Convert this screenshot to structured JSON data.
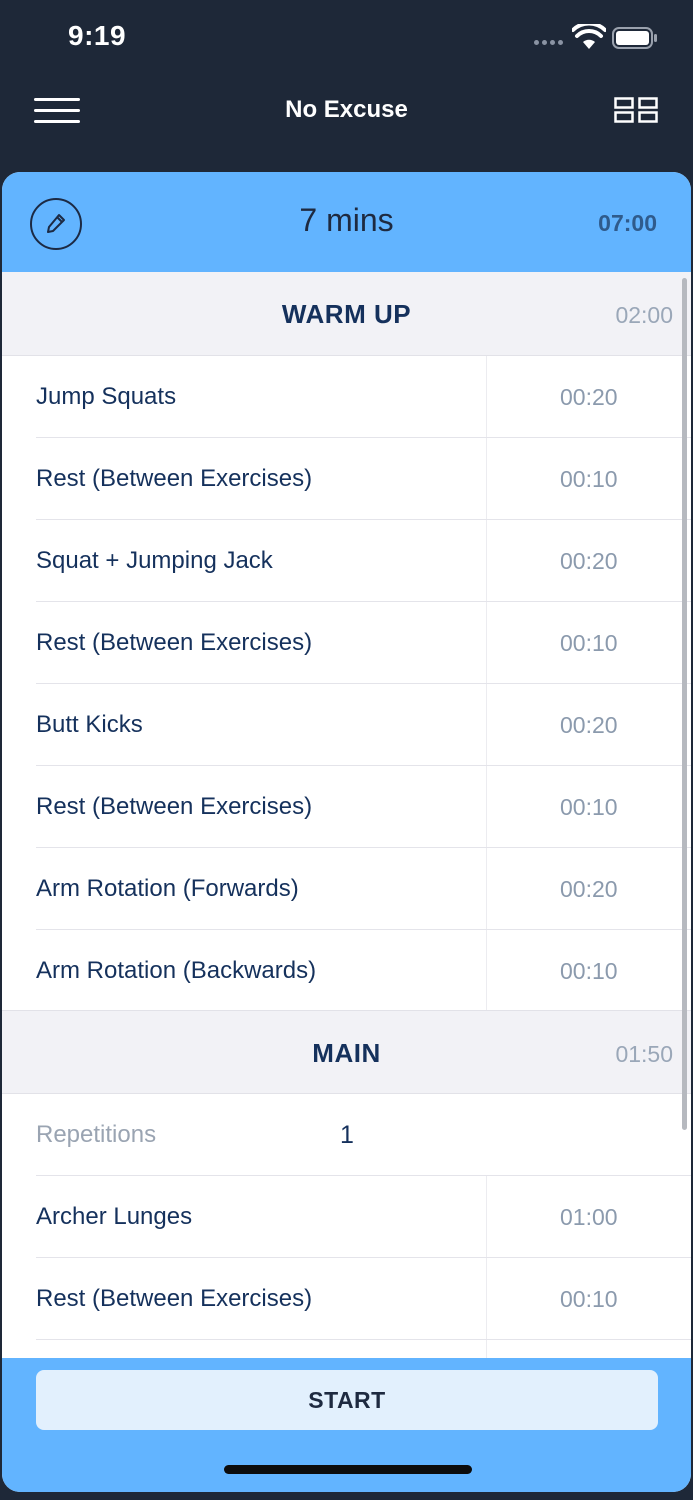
{
  "status": {
    "time": "9:19"
  },
  "nav": {
    "title": "No Excuse"
  },
  "header": {
    "title": "7 mins",
    "total": "07:00"
  },
  "sections": [
    {
      "title": "WARM UP",
      "time": "02:00",
      "items": [
        {
          "name": "Jump Squats",
          "time": "00:20"
        },
        {
          "name": "Rest (Between Exercises)",
          "time": "00:10"
        },
        {
          "name": "Squat + Jumping Jack",
          "time": "00:20"
        },
        {
          "name": "Rest (Between Exercises)",
          "time": "00:10"
        },
        {
          "name": "Butt Kicks",
          "time": "00:20"
        },
        {
          "name": "Rest (Between Exercises)",
          "time": "00:10"
        },
        {
          "name": "Arm Rotation (Forwards)",
          "time": "00:20"
        },
        {
          "name": "Arm Rotation (Backwards)",
          "time": "00:10"
        }
      ]
    },
    {
      "title": "MAIN",
      "time": "01:50",
      "repetitions_label": "Repetitions",
      "repetitions_value": "1",
      "items": [
        {
          "name": "Archer Lunges",
          "time": "01:00"
        },
        {
          "name": "Rest (Between Exercises)",
          "time": "00:10"
        }
      ]
    }
  ],
  "footer": {
    "start_label": "START"
  },
  "colors": {
    "accent": "#62b4ff",
    "background": "#1e2838",
    "text": "#15315c"
  },
  "icons": [
    "wifi-icon",
    "battery-icon",
    "menu-icon",
    "grid-icon",
    "pencil-icon"
  ]
}
